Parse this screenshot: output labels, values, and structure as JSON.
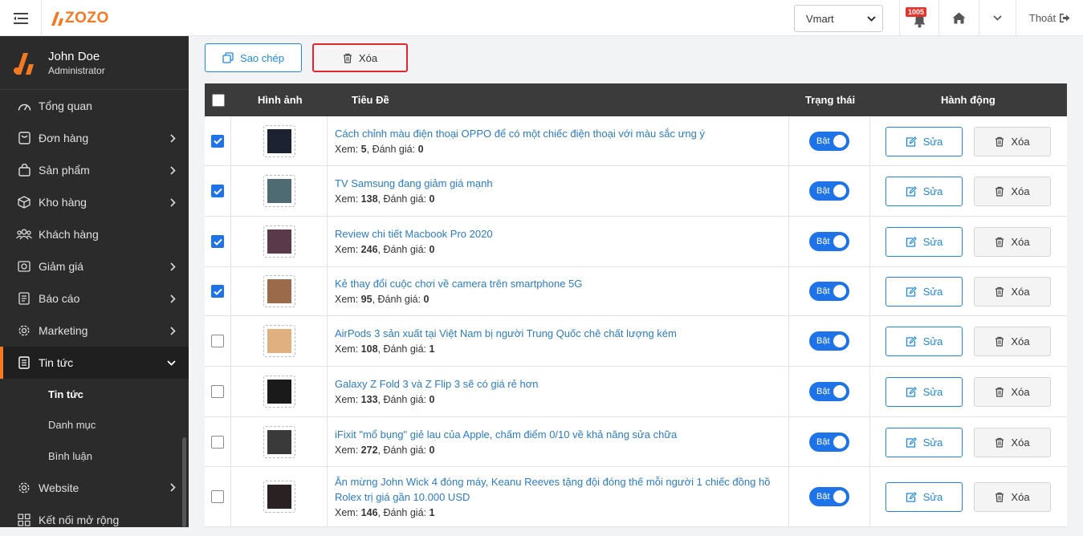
{
  "header": {
    "logo_text": "ZOZO",
    "store_select": "Vmart",
    "notification_count": "1005",
    "logout_label": "Thoát"
  },
  "profile": {
    "name": "John Doe",
    "role": "Administrator"
  },
  "sidebar": {
    "items": [
      {
        "label": "Tổng quan",
        "icon": "dashboard-icon",
        "has_arrow": false
      },
      {
        "label": "Đơn hàng",
        "icon": "order-icon",
        "has_arrow": true
      },
      {
        "label": "Sản phẩm",
        "icon": "bag-icon",
        "has_arrow": true
      },
      {
        "label": "Kho hàng",
        "icon": "box-icon",
        "has_arrow": true
      },
      {
        "label": "Khách hàng",
        "icon": "users-icon",
        "has_arrow": false
      },
      {
        "label": "Giảm giá",
        "icon": "discount-icon",
        "has_arrow": true
      },
      {
        "label": "Báo cáo",
        "icon": "report-icon",
        "has_arrow": true
      },
      {
        "label": "Marketing",
        "icon": "gear-icon",
        "has_arrow": true
      },
      {
        "label": "Tin tức",
        "icon": "document-icon",
        "has_arrow": true,
        "active": true
      }
    ],
    "sub_items": [
      {
        "label": "Tin tức",
        "current": true
      },
      {
        "label": "Danh mục"
      },
      {
        "label": "Bình luận"
      }
    ],
    "bottom_items": [
      {
        "label": "Website",
        "icon": "gear-icon",
        "has_arrow": true
      },
      {
        "label": "Kết nối mở rộng",
        "icon": "grid-icon",
        "has_arrow": false
      }
    ]
  },
  "toolbar": {
    "copy_label": "Sao chép",
    "delete_label": "Xóa"
  },
  "table": {
    "columns": [
      "Hình ảnh",
      "Tiêu Đề",
      "Trạng thái",
      "Hành động"
    ],
    "view_label": "Xem:",
    "rating_label": "Đánh giá:",
    "edit_label": "Sửa",
    "delete_label": "Xóa",
    "rows": [
      {
        "checked": true,
        "title": "Cách chỉnh màu điện thoại OPPO để có một chiếc điện thoại với màu sắc ưng ý",
        "views": "5",
        "rating": "0",
        "status": "Bật",
        "thumb": "#1c2230"
      },
      {
        "checked": true,
        "title": "TV Samsung đang giảm giá mạnh",
        "views": "138",
        "rating": "0",
        "status": "Bật",
        "thumb": "#4e6a72"
      },
      {
        "checked": true,
        "title": "Review chi tiết Macbook Pro 2020",
        "views": "246",
        "rating": "0",
        "status": "Bật",
        "thumb": "#5a3a4a"
      },
      {
        "checked": true,
        "title": "Kẻ thay đổi cuộc chơi về camera trên smartphone 5G",
        "views": "95",
        "rating": "0",
        "status": "Bật",
        "thumb": "#9a6a4a"
      },
      {
        "checked": false,
        "title": "AirPods 3 sản xuất tại Việt Nam bị người Trung Quốc chê chất lượng kém",
        "views": "108",
        "rating": "1",
        "status": "Bật",
        "thumb": "#e0b080"
      },
      {
        "checked": false,
        "title": "Galaxy Z Fold 3 và Z Flip 3 sẽ có giá rẻ hơn",
        "views": "133",
        "rating": "0",
        "status": "Bật",
        "thumb": "#1a1a1a"
      },
      {
        "checked": false,
        "title": "iFixit \"mổ bụng\" giẻ lau của Apple, chấm điểm 0/10 về khả năng sửa chữa",
        "views": "272",
        "rating": "0",
        "status": "Bật",
        "thumb": "#3a3a3a"
      },
      {
        "checked": false,
        "title": "Ăn mừng John Wick 4 đóng máy, Keanu Reeves tặng đội đóng thế mỗi người 1 chiếc đồng hồ Rolex trị giá gần 10.000 USD",
        "views": "146",
        "rating": "1",
        "status": "Bật",
        "thumb": "#2a2222"
      }
    ]
  },
  "colors": {
    "accent": "#f47920",
    "primary": "#1e73e8",
    "danger": "#e3262b"
  }
}
